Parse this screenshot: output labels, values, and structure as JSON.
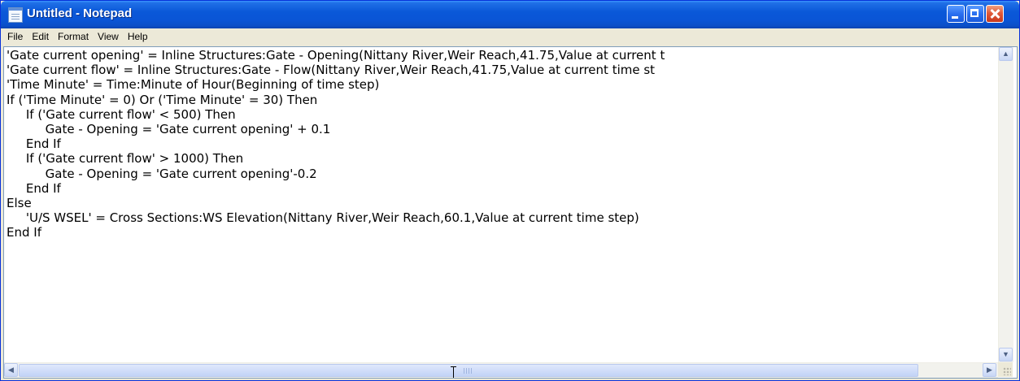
{
  "window": {
    "title": "Untitled - Notepad"
  },
  "menu": {
    "items": [
      "File",
      "Edit",
      "Format",
      "View",
      "Help"
    ]
  },
  "editor": {
    "text": "'Gate current opening' = Inline Structures:Gate - Opening(Nittany River,Weir Reach,41.75,Value at current t\n'Gate current flow' = Inline Structures:Gate - Flow(Nittany River,Weir Reach,41.75,Value at current time st\n'Time Minute' = Time:Minute of Hour(Beginning of time step)\nIf ('Time Minute' = 0) Or ('Time Minute' = 30) Then\n     If ('Gate current flow' < 500) Then\n          Gate - Opening = 'Gate current opening' + 0.1\n     End If\n     If ('Gate current flow' > 1000) Then\n          Gate - Opening = 'Gate current opening'-0.2\n     End If\nElse\n     'U/S WSEL' = Cross Sections:WS Elevation(Nittany River,Weir Reach,60.1,Value at current time step)\nEnd If"
  },
  "colors": {
    "titlebar": "#0a58d8",
    "close_button": "#e05a3a",
    "menubar": "#ece9d8",
    "editor_background": "#ffffff"
  },
  "icons": {
    "app": "notepad-icon",
    "minimize": "minimize-icon",
    "maximize": "maximize-icon",
    "close": "close-icon",
    "scroll_up": "arrow-up-icon",
    "scroll_down": "arrow-down-icon",
    "scroll_left": "arrow-left-icon",
    "scroll_right": "arrow-right-icon",
    "cursor": "text-cursor-icon"
  }
}
